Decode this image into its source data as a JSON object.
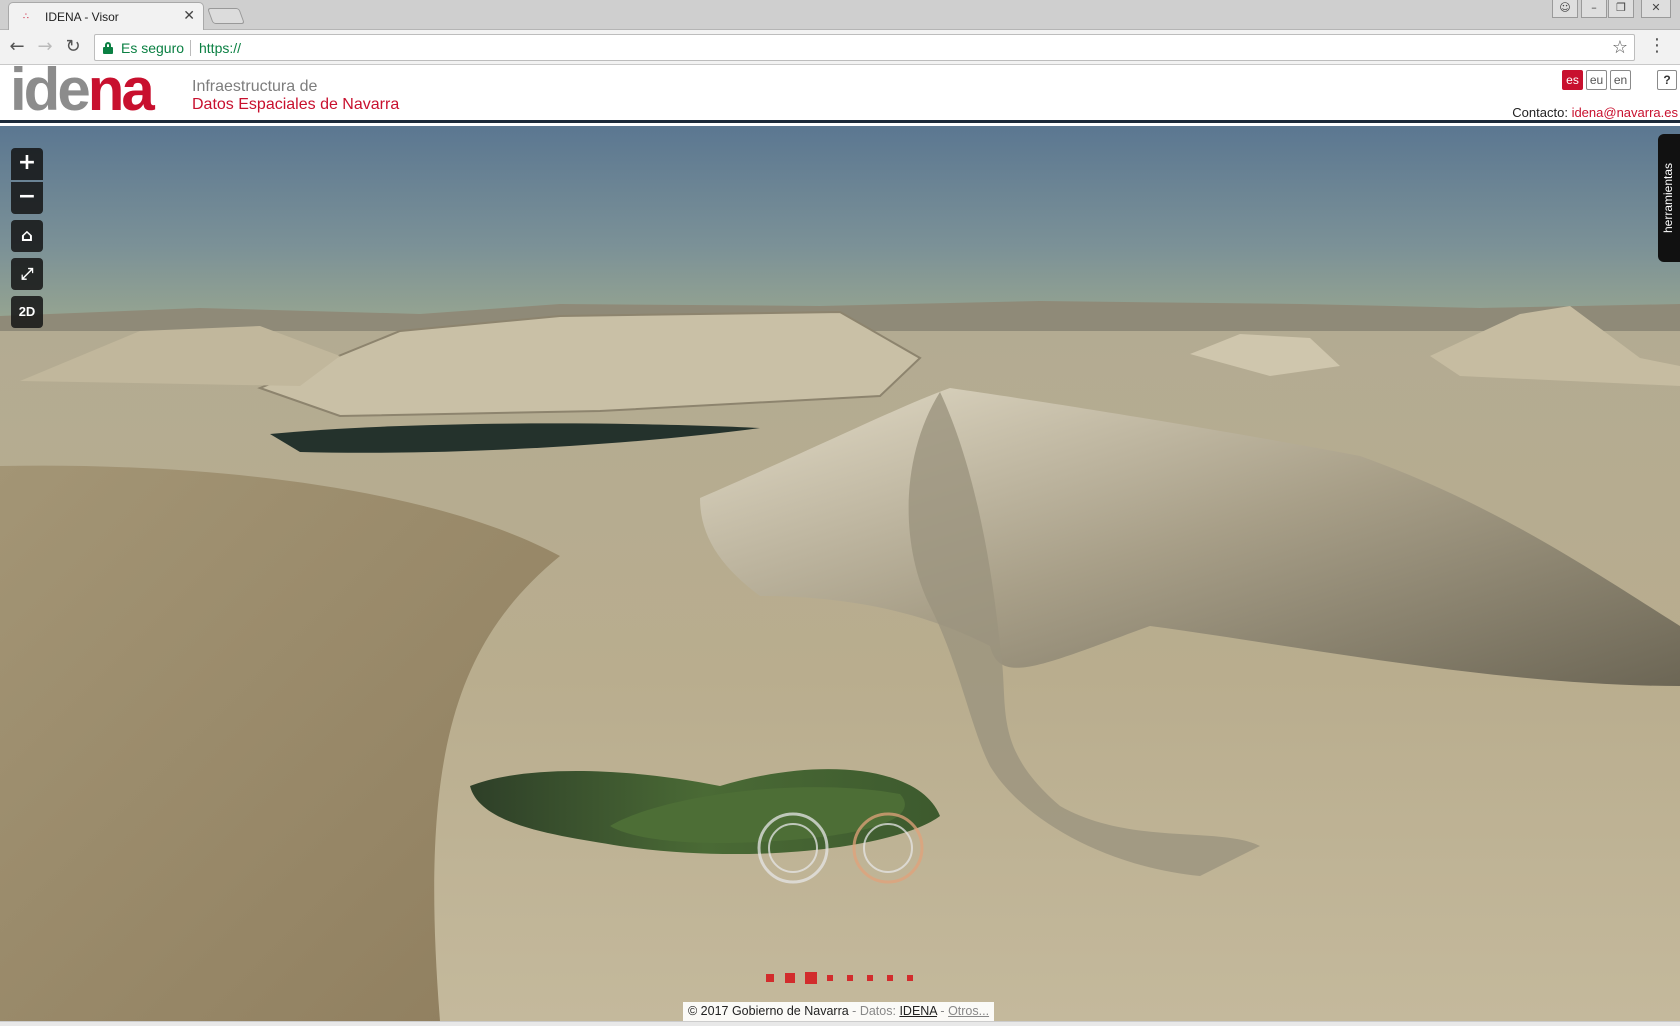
{
  "browser": {
    "tab_title": "IDENA - Visor",
    "secure_label": "Es seguro",
    "url": "https://",
    "icons": [
      "back-icon",
      "forward-icon",
      "reload-icon",
      "lock-icon",
      "star-icon",
      "menu-icon",
      "close-icon",
      "user-icon",
      "minimize-icon",
      "restore-icon"
    ]
  },
  "header": {
    "logo_grey": "ide",
    "logo_red": "na",
    "brand_line1": "Infraestructura de",
    "brand_line2": "Datos Espaciales de Navarra",
    "languages": [
      "es",
      "eu",
      "en"
    ],
    "active_language": "es",
    "help_label": "?",
    "contact_label": "Contacto:",
    "contact_email": "idena@navarra.es"
  },
  "map": {
    "controls": {
      "zoom_in": "+",
      "zoom_out": "−",
      "view_toggle": "2D"
    },
    "tools_label": "herramientas",
    "attribution": {
      "copyright": "© 2017 Gobierno de Navarra",
      "sep1": " - ",
      "datos": "Datos:",
      "idena": "IDENA",
      "sep2": " - ",
      "otros": "Otros..."
    },
    "colors": {
      "accent": "#c8102e",
      "sky_top": "#5a7690",
      "sky_bottom": "#8fa394",
      "terrain": "#b8ac8f",
      "water": "#3d5a2e"
    }
  }
}
